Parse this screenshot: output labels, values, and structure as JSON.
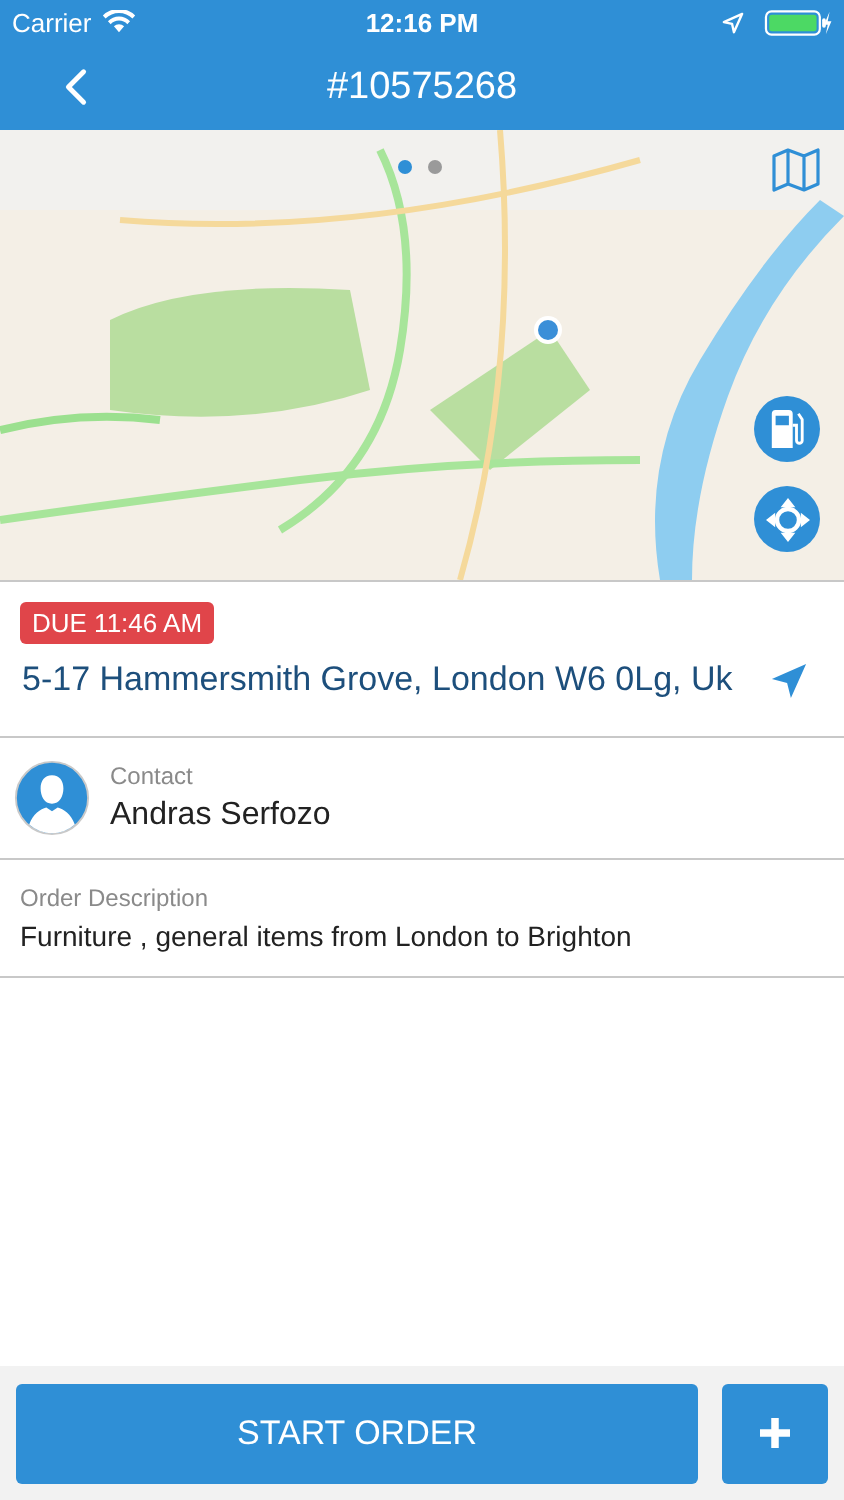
{
  "status_bar": {
    "carrier": "Carrier",
    "time": "12:16 PM"
  },
  "nav": {
    "title": "#10575268"
  },
  "map": {
    "pages": [
      {
        "selected": true
      },
      {
        "selected": false
      }
    ]
  },
  "order": {
    "due": "DUE 11:46 AM",
    "address": "5-17 Hammersmith Grove, London W6 0Lg, Uk"
  },
  "contact": {
    "label": "Contact",
    "name": "Andras Serfozo"
  },
  "description": {
    "label": "Order Description",
    "text": "Furniture , general items from London to Brighton"
  },
  "actions": {
    "primary": "START ORDER"
  }
}
